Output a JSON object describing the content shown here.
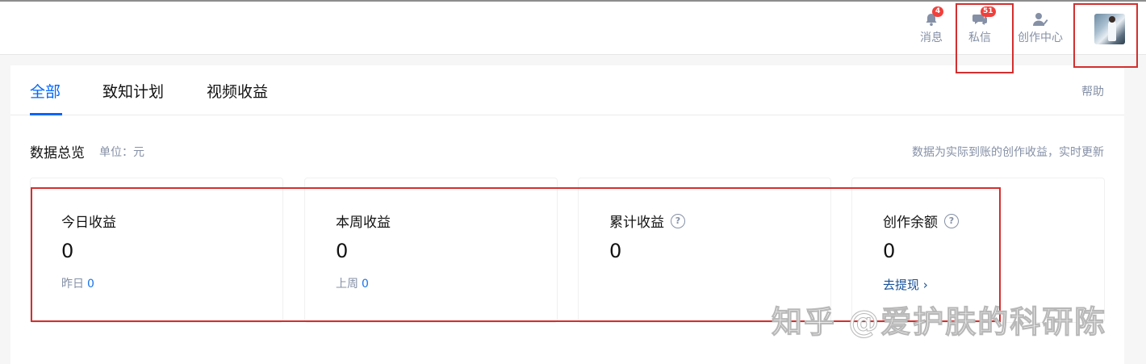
{
  "topbar": {
    "messages": {
      "label": "消息",
      "badge": "4"
    },
    "dm": {
      "label": "私信",
      "badge": "51"
    },
    "creator": {
      "label": "创作中心"
    }
  },
  "tabs": [
    {
      "label": "全部",
      "active": true
    },
    {
      "label": "致知计划"
    },
    {
      "label": "视频收益"
    }
  ],
  "help": "帮助",
  "overview": {
    "title": "数据总览",
    "unit": "单位：元",
    "note": "数据为实际到账的创作收益，实时更新"
  },
  "stats": [
    {
      "title": "今日收益",
      "value": "0",
      "sub_label": "昨日",
      "sub_value": "0"
    },
    {
      "title": "本周收益",
      "value": "0",
      "sub_label": "上周",
      "sub_value": "0"
    },
    {
      "title": "累计收益",
      "value": "0",
      "help_icon": "question-icon"
    },
    {
      "title": "创作余额",
      "value": "0",
      "help_icon": "question-icon",
      "link": "去提现 ›"
    }
  ],
  "watermark": "知乎 @爱护肤的科研陈",
  "colors": {
    "accent": "#0066ff",
    "badge": "#f1403c",
    "highlight_box": "#d32f2f"
  }
}
